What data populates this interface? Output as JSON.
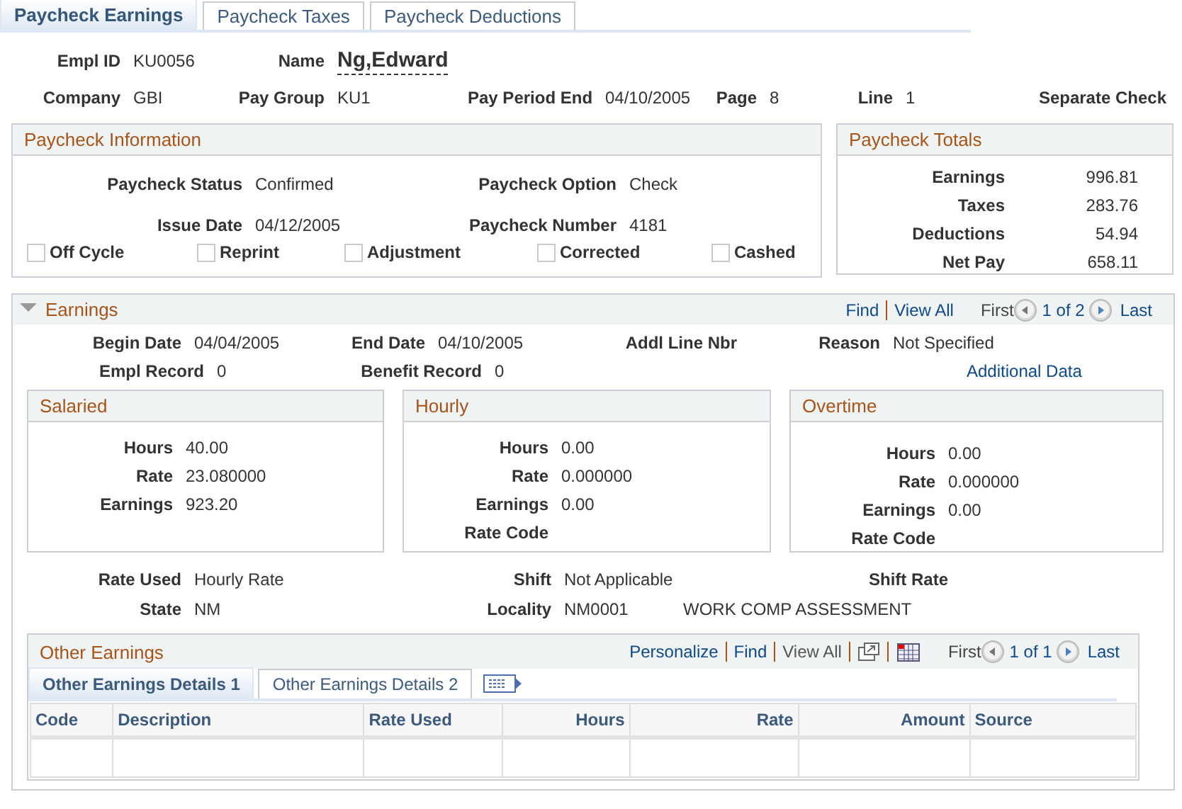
{
  "tabs": [
    {
      "label": "Paycheck Earnings",
      "selected": true
    },
    {
      "label": "Paycheck Taxes",
      "selected": false
    },
    {
      "label": "Paycheck Deductions",
      "selected": false
    }
  ],
  "header": {
    "rows": [
      [
        {
          "kind": "text",
          "label": "Empl ID",
          "value": "KU0056"
        },
        {
          "kind": "name",
          "label": "Name",
          "value": "Ng,Edward"
        }
      ],
      [
        {
          "kind": "text",
          "label": "Company",
          "value": "GBI"
        },
        {
          "kind": "text",
          "label": "Pay Group",
          "value": "KU1"
        },
        {
          "kind": "text",
          "label": "Pay Period End",
          "value": "04/10/2005"
        },
        {
          "kind": "text",
          "label": "Page",
          "value": "8"
        },
        {
          "kind": "text",
          "label": "Line",
          "value": "1"
        },
        {
          "kind": "text",
          "label": "Separate Check"
        }
      ]
    ]
  },
  "paycheck_information": {
    "title": "Paycheck Information",
    "rows": [
      [
        {
          "label": "Paycheck Status",
          "value": "Confirmed"
        },
        {
          "label": "Paycheck Option",
          "value": "Check"
        }
      ],
      [
        {
          "label": "Issue Date",
          "value": "04/12/2005"
        },
        {
          "label": "Paycheck Number",
          "value": "4181"
        }
      ]
    ],
    "checkboxes": [
      {
        "label": "Off Cycle",
        "checked": false
      },
      {
        "label": "Reprint",
        "checked": false
      },
      {
        "label": "Adjustment",
        "checked": false
      },
      {
        "label": "Corrected",
        "checked": false
      },
      {
        "label": "Cashed",
        "checked": false
      }
    ]
  },
  "paycheck_totals": {
    "title": "Paycheck Totals",
    "rows": [
      {
        "label": "Earnings",
        "value": "996.81"
      },
      {
        "label": "Taxes",
        "value": "283.76"
      },
      {
        "label": "Deductions",
        "value": "54.94"
      },
      {
        "label": "Net Pay",
        "value": "658.11"
      }
    ]
  },
  "earnings": {
    "title": "Earnings",
    "expanded": true,
    "nav": {
      "links": [
        {
          "label": "Find",
          "disabled": false
        },
        {
          "label": "View All",
          "disabled": false
        }
      ],
      "first": "First",
      "position": "1 of 2",
      "last": "Last"
    },
    "rows": [
      [
        {
          "label": "Begin Date",
          "value": "04/04/2005"
        },
        {
          "label": "End Date",
          "value": "04/10/2005"
        },
        {
          "label": "Addl Line Nbr"
        },
        {
          "label": "Reason",
          "value": "Not Specified"
        }
      ],
      [
        {
          "label": "Empl Record",
          "value": "0"
        },
        {
          "label": "Benefit Record",
          "value": "0"
        }
      ]
    ],
    "additional_data": "Additional Data",
    "groups": [
      {
        "title": "Salaried",
        "rows": [
          {
            "label": "Hours",
            "value": "40.00"
          },
          {
            "label": "Rate",
            "value": "23.080000"
          },
          {
            "label": "Earnings",
            "value": "923.20"
          }
        ]
      },
      {
        "title": "Hourly",
        "rows": [
          {
            "label": "Hours",
            "value": "0.00"
          },
          {
            "label": "Rate",
            "value": "0.000000"
          },
          {
            "label": "Earnings",
            "value": "0.00"
          },
          {
            "label": "Rate Code"
          }
        ]
      },
      {
        "title": "Overtime",
        "rows": [
          {
            "label": "Hours",
            "value": "0.00"
          },
          {
            "label": "Rate",
            "value": "0.000000"
          },
          {
            "label": "Earnings",
            "value": "0.00"
          },
          {
            "label": "Rate Code"
          }
        ]
      }
    ],
    "details": [
      [
        {
          "label": "Rate Used",
          "value": "Hourly Rate"
        },
        {
          "label": "Shift",
          "value": "Not Applicable"
        },
        {
          "label": "Shift Rate"
        }
      ],
      [
        {
          "label": "State",
          "value": "NM"
        },
        {
          "label": "Locality",
          "value": "NM0001",
          "description": "WORK COMP ASSESSMENT"
        }
      ]
    ],
    "other_earnings": {
      "title": "Other Earnings",
      "nav": {
        "links": [
          {
            "label": "Personalize",
            "disabled": false
          },
          {
            "label": "Find",
            "disabled": false
          },
          {
            "label": "View All",
            "disabled": true
          }
        ],
        "first": "First",
        "position": "1 of 1",
        "last": "Last"
      },
      "tabs": [
        {
          "label": "Other Earnings Details 1",
          "selected": true
        },
        {
          "label": "Other Earnings Details 2",
          "selected": false
        }
      ],
      "columns": [
        {
          "label": "Code",
          "kind": "text"
        },
        {
          "label": "Description",
          "kind": "text"
        },
        {
          "label": "Rate Used",
          "kind": "text"
        },
        {
          "label": "Hours",
          "kind": "number"
        },
        {
          "label": "Rate",
          "kind": "number"
        },
        {
          "label": "Amount",
          "kind": "number"
        },
        {
          "label": "Source",
          "kind": "text"
        }
      ]
    }
  }
}
